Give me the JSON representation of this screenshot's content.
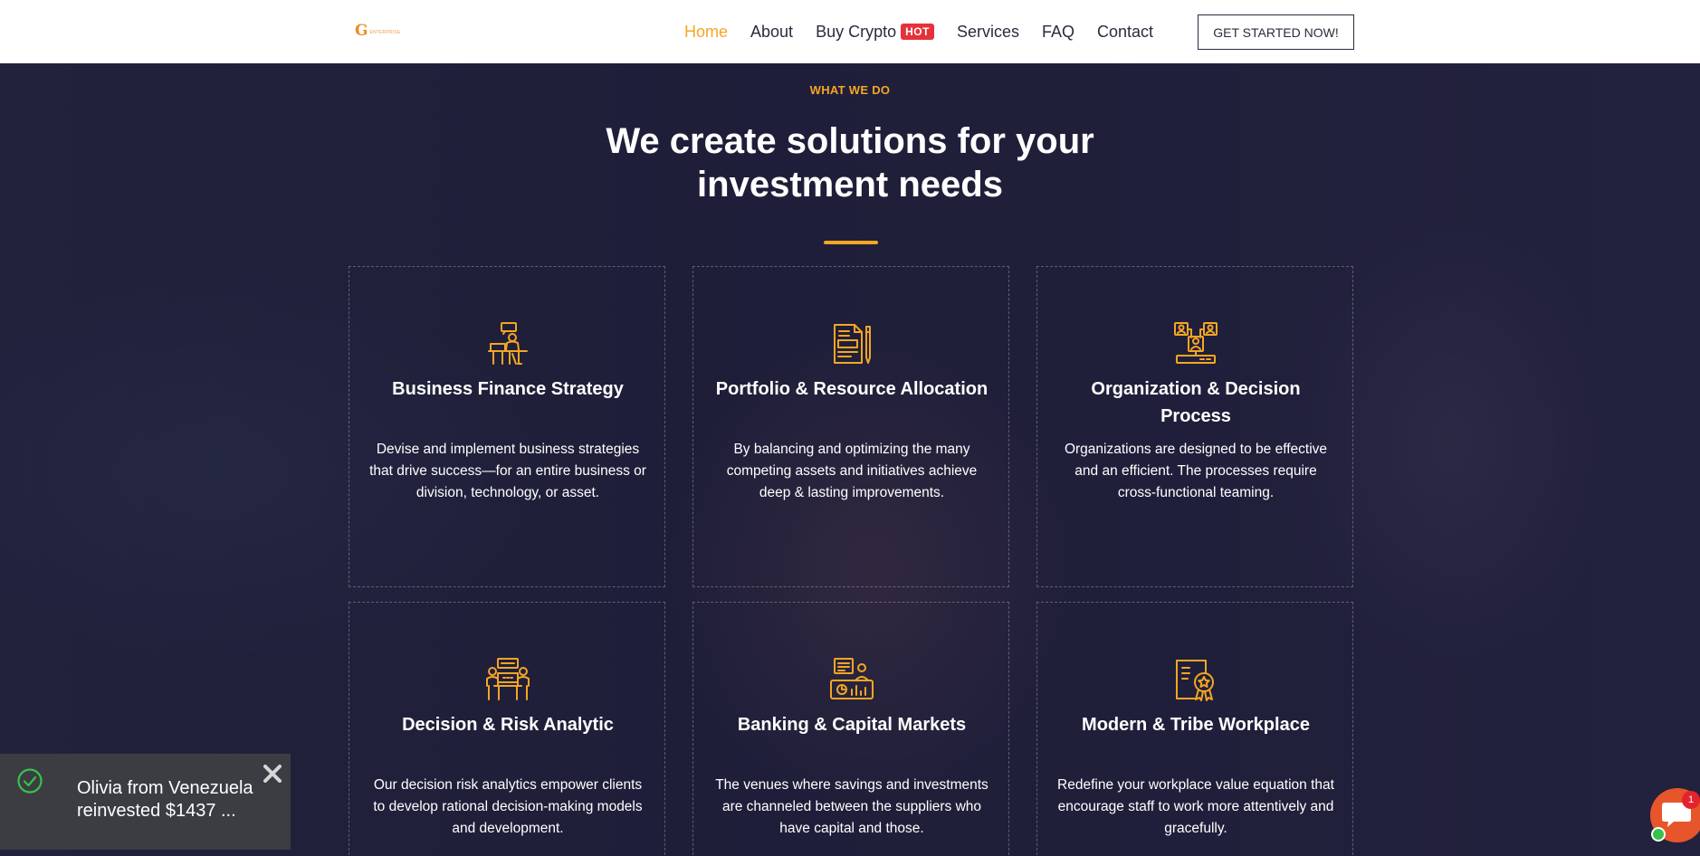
{
  "header": {
    "logo": {
      "letter": "G",
      "text": "ENTERPRISE"
    },
    "nav": [
      {
        "label": "Home",
        "active": true
      },
      {
        "label": "About"
      },
      {
        "label": "Buy Crypto",
        "badge": "HOT"
      },
      {
        "label": "Services"
      },
      {
        "label": "FAQ"
      },
      {
        "label": "Contact"
      }
    ],
    "cta_label": "GET STARTED NOW!"
  },
  "section": {
    "eyebrow": "WHAT WE DO",
    "title": "We create solutions for your investment needs"
  },
  "services": [
    {
      "icon": "presenter-desk-icon",
      "title": "Business Finance Strategy",
      "desc": "Devise and implement business strategies that drive success—for an entire business or division, technology, or asset."
    },
    {
      "icon": "document-pen-icon",
      "title": "Portfolio & Resource Allocation",
      "desc": "By balancing and optimizing the many competing assets and initiatives achieve deep & lasting improvements."
    },
    {
      "icon": "team-network-icon",
      "title": "Organization & Decision Process",
      "desc": "Organizations are designed to be effective and an efficient. The processes require cross-functional teaming."
    },
    {
      "icon": "meeting-table-icon",
      "title": "Decision & Risk Analytic",
      "desc": "Our decision risk analytics empower clients to develop rational decision-making models and development."
    },
    {
      "icon": "analytics-screen-icon",
      "title": "Banking & Capital Markets",
      "desc": "The venues where savings and investments are channeled between the suppliers who have capital and those."
    },
    {
      "icon": "certificate-award-icon",
      "title": "Modern & Tribe Workplace",
      "desc": "Redefine your workplace value equation that encourage staff to work more attentively and gracefully."
    }
  ],
  "toast": {
    "message": "Olivia from Venezuela reinvested $1437 ..."
  },
  "chat": {
    "badge_count": "1"
  },
  "colors": {
    "accent": "#f5a623",
    "hot_badge": "#e6313b",
    "chat": "#e7552a",
    "toast_bg": "#3b3d42",
    "success": "#37c24a"
  }
}
